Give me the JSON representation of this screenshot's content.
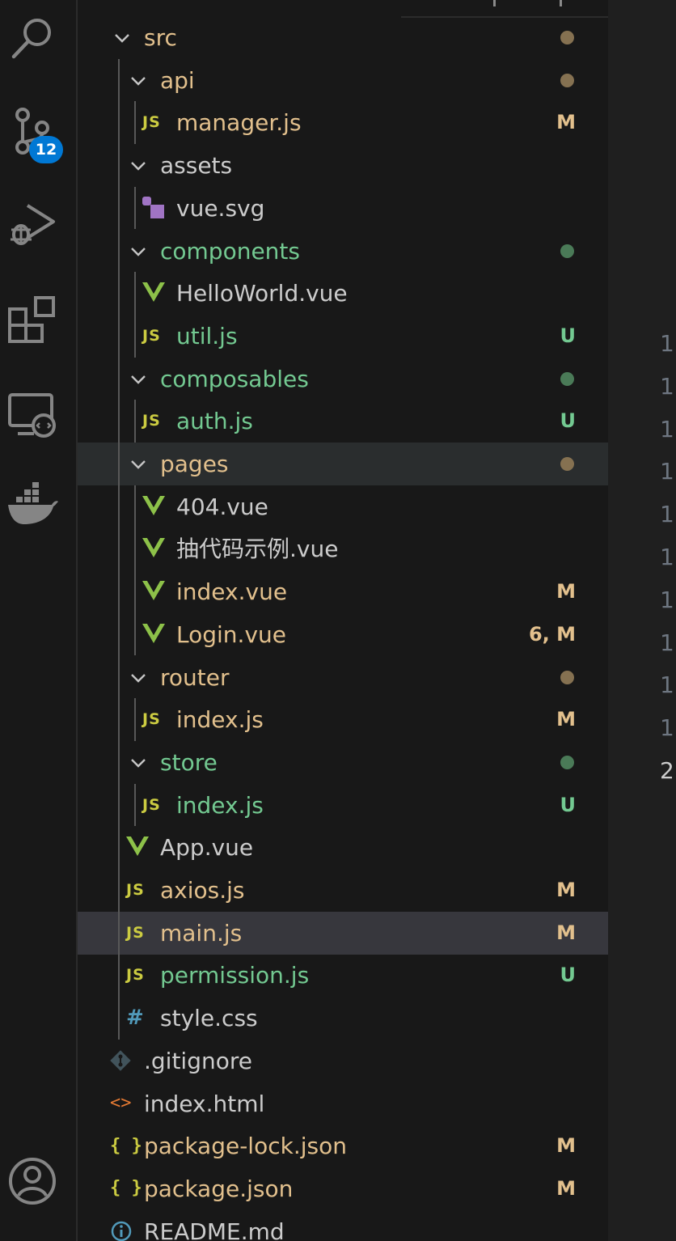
{
  "activity_bar": {
    "items": [
      {
        "name": "search-icon"
      },
      {
        "name": "source-control-icon",
        "badge": "12"
      },
      {
        "name": "run-debug-icon"
      },
      {
        "name": "extensions-icon"
      },
      {
        "name": "remote-explorer-icon"
      },
      {
        "name": "docker-icon"
      },
      {
        "name": "accounts-icon"
      }
    ],
    "badge_color": "#0078d4"
  },
  "colors": {
    "modified": "#e2c08d",
    "untracked": "#73c991",
    "vue_icon": "#8dc149",
    "js_icon": "#cbcb41"
  },
  "tree": [
    {
      "label": "src",
      "kind": "folder",
      "depth": 0,
      "git": "modified-dot"
    },
    {
      "label": "api",
      "kind": "folder",
      "depth": 1,
      "git": "modified-dot"
    },
    {
      "label": "manager.js",
      "kind": "js",
      "depth": 2,
      "status": "M"
    },
    {
      "label": "assets",
      "kind": "folder",
      "depth": 1
    },
    {
      "label": "vue.svg",
      "kind": "svg",
      "depth": 2
    },
    {
      "label": "components",
      "kind": "folder",
      "depth": 1,
      "git": "new-dot"
    },
    {
      "label": "HelloWorld.vue",
      "kind": "vue",
      "depth": 2
    },
    {
      "label": "util.js",
      "kind": "js",
      "depth": 2,
      "status": "U"
    },
    {
      "label": "composables",
      "kind": "folder",
      "depth": 1,
      "git": "new-dot"
    },
    {
      "label": "auth.js",
      "kind": "js",
      "depth": 2,
      "status": "U"
    },
    {
      "label": "pages",
      "kind": "folder",
      "depth": 1,
      "git": "modified-dot",
      "state": "focus"
    },
    {
      "label": "404.vue",
      "kind": "vue",
      "depth": 2
    },
    {
      "label": "抽代码示例.vue",
      "kind": "vue",
      "depth": 2
    },
    {
      "label": "index.vue",
      "kind": "vue",
      "depth": 2,
      "status": "M"
    },
    {
      "label": "Login.vue",
      "kind": "vue",
      "depth": 2,
      "status": "6, M"
    },
    {
      "label": "router",
      "kind": "folder",
      "depth": 1,
      "git": "modified-dot"
    },
    {
      "label": "index.js",
      "kind": "js",
      "depth": 2,
      "status": "M"
    },
    {
      "label": "store",
      "kind": "folder",
      "depth": 1,
      "git": "new-dot"
    },
    {
      "label": "index.js",
      "kind": "js",
      "depth": 2,
      "status": "U"
    },
    {
      "label": "App.vue",
      "kind": "vue",
      "depth": 1
    },
    {
      "label": "axios.js",
      "kind": "js",
      "depth": 1,
      "status": "M"
    },
    {
      "label": "main.js",
      "kind": "js",
      "depth": 1,
      "status": "M",
      "state": "selected"
    },
    {
      "label": "permission.js",
      "kind": "js",
      "depth": 1,
      "status": "U"
    },
    {
      "label": "style.css",
      "kind": "css",
      "depth": 1
    },
    {
      "label": ".gitignore",
      "kind": "git",
      "depth": 0
    },
    {
      "label": "index.html",
      "kind": "html",
      "depth": 0
    },
    {
      "label": "package-lock.json",
      "kind": "json",
      "depth": 0,
      "status": "M"
    },
    {
      "label": "package.json",
      "kind": "json",
      "depth": 0,
      "status": "M"
    },
    {
      "label": "README.md",
      "kind": "info",
      "depth": 0
    }
  ],
  "gutter": {
    "lines": [
      "1",
      "1",
      "1",
      "1",
      "1",
      "1",
      "1",
      "1",
      "1",
      "1",
      "2"
    ]
  }
}
